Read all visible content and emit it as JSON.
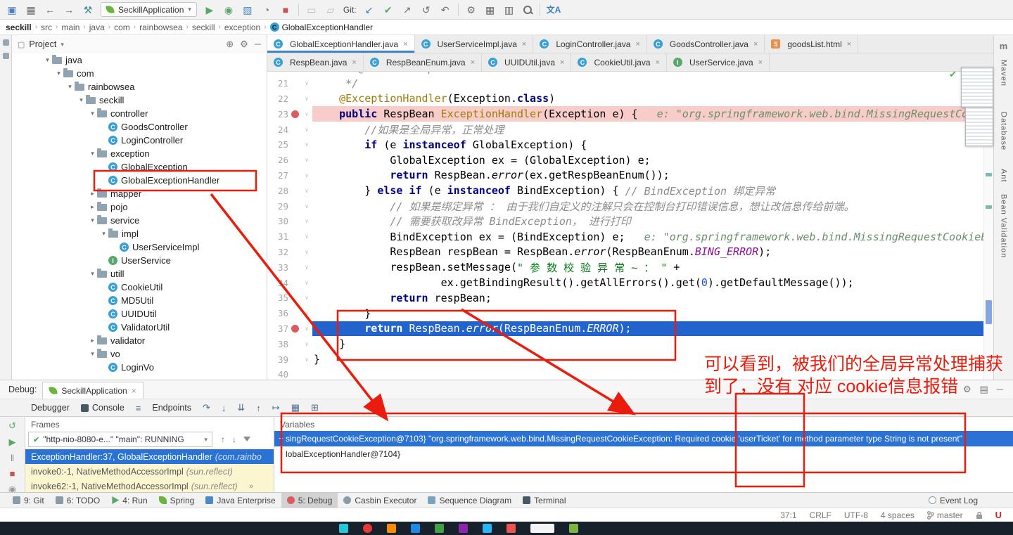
{
  "toolbar": {
    "run_config": "SeckillApplication",
    "git_label": "Git:"
  },
  "breadcrumb": {
    "items": [
      "seckill",
      "src",
      "main",
      "java",
      "com",
      "rainbowsea",
      "seckill",
      "exception",
      "GlobalExceptionHandler"
    ]
  },
  "project_panel": {
    "title": "Project",
    "tree": [
      {
        "label": "java",
        "indent": 2,
        "type": "folder",
        "state": "expanded"
      },
      {
        "label": "com",
        "indent": 3,
        "type": "folder",
        "state": "expanded"
      },
      {
        "label": "rainbowsea",
        "indent": 4,
        "type": "folder",
        "state": "expanded"
      },
      {
        "label": "seckill",
        "indent": 5,
        "type": "folder",
        "state": "expanded"
      },
      {
        "label": "controller",
        "indent": 6,
        "type": "folder",
        "state": "expanded"
      },
      {
        "label": "GoodsController",
        "indent": 7,
        "type": "class"
      },
      {
        "label": "LoginController",
        "indent": 7,
        "type": "class"
      },
      {
        "label": "exception",
        "indent": 6,
        "type": "folder",
        "state": "expanded"
      },
      {
        "label": "GlobalException",
        "indent": 7,
        "type": "class"
      },
      {
        "label": "GlobalExceptionHandler",
        "indent": 7,
        "type": "class",
        "highlight": true
      },
      {
        "label": "mapper",
        "indent": 6,
        "type": "folder",
        "state": "collapsed"
      },
      {
        "label": "pojo",
        "indent": 6,
        "type": "folder",
        "state": "collapsed"
      },
      {
        "label": "service",
        "indent": 6,
        "type": "folder",
        "state": "expanded"
      },
      {
        "label": "impl",
        "indent": 7,
        "type": "folder",
        "state": "expanded"
      },
      {
        "label": "UserServiceImpl",
        "indent": 8,
        "type": "class"
      },
      {
        "label": "UserService",
        "indent": 7,
        "type": "interface"
      },
      {
        "label": "utill",
        "indent": 6,
        "type": "folder",
        "state": "expanded"
      },
      {
        "label": "CookieUtil",
        "indent": 7,
        "type": "class"
      },
      {
        "label": "MD5Util",
        "indent": 7,
        "type": "class"
      },
      {
        "label": "UUIDUtil",
        "indent": 7,
        "type": "class"
      },
      {
        "label": "ValidatorUtil",
        "indent": 7,
        "type": "class"
      },
      {
        "label": "validator",
        "indent": 6,
        "type": "folder",
        "state": "collapsed"
      },
      {
        "label": "vo",
        "indent": 6,
        "type": "folder",
        "state": "expanded"
      },
      {
        "label": "LoginVo",
        "indent": 7,
        "type": "class"
      }
    ]
  },
  "editor": {
    "tab_rows": [
      [
        {
          "label": "GlobalExceptionHandler.java",
          "icon": "class",
          "selected": true
        },
        {
          "label": "UserServiceImpl.java",
          "icon": "class"
        },
        {
          "label": "LoginController.java",
          "icon": "class"
        },
        {
          "label": "GoodsController.java",
          "icon": "class"
        },
        {
          "label": "goodsList.html",
          "icon": "html"
        }
      ],
      [
        {
          "label": "RespBean.java",
          "icon": "class"
        },
        {
          "label": "RespBeanEnum.java",
          "icon": "class"
        },
        {
          "label": "UUIDUtil.java",
          "icon": "class"
        },
        {
          "label": "CookieUtil.java",
          "icon": "class"
        },
        {
          "label": "UserService.java",
          "icon": "interface"
        }
      ]
    ],
    "lines": [
      {
        "n": 20,
        "t": [
          [
            "c",
            "     * @return RespBean"
          ]
        ]
      },
      {
        "n": 21,
        "t": [
          [
            "c",
            "     */"
          ]
        ]
      },
      {
        "n": 22,
        "t": [
          [
            "p",
            "    "
          ],
          [
            "a",
            "@ExceptionHandler"
          ],
          [
            "p",
            "("
          ],
          [
            "p",
            "Exception."
          ],
          [
            "k",
            "class"
          ],
          [
            "p",
            ")"
          ]
        ]
      },
      {
        "n": 23,
        "bg": "bp",
        "bp": true,
        "t": [
          [
            "p",
            "    "
          ],
          [
            "k",
            "public"
          ],
          [
            "p",
            " RespBean "
          ],
          [
            "d",
            "ExceptionHandler"
          ],
          [
            "p",
            "(Exception e) {"
          ],
          [
            "h",
            "   e: \"org.springframework.web.bind.MissingRequestCookieExce"
          ]
        ]
      },
      {
        "n": 24,
        "t": [
          [
            "p",
            "        "
          ],
          [
            "c",
            "//如果是全局异常，正常处理"
          ]
        ]
      },
      {
        "n": 25,
        "t": [
          [
            "p",
            "        "
          ],
          [
            "k",
            "if"
          ],
          [
            "p",
            " (e "
          ],
          [
            "k",
            "instanceof"
          ],
          [
            "p",
            " GlobalException) {"
          ]
        ]
      },
      {
        "n": 26,
        "t": [
          [
            "p",
            "            GlobalException ex = (GlobalException) e;"
          ]
        ]
      },
      {
        "n": 27,
        "t": [
          [
            "p",
            "            "
          ],
          [
            "k",
            "return"
          ],
          [
            "p",
            " RespBean."
          ],
          [
            "i",
            "error"
          ],
          [
            "p",
            "(ex.getRespBeanEnum());"
          ]
        ]
      },
      {
        "n": 28,
        "t": [
          [
            "p",
            "        } "
          ],
          [
            "k",
            "else"
          ],
          [
            "p",
            " "
          ],
          [
            "k",
            "if"
          ],
          [
            "p",
            " (e "
          ],
          [
            "k",
            "instanceof"
          ],
          [
            "p",
            " BindException) { "
          ],
          [
            "c",
            "// BindException 绑定异常"
          ]
        ]
      },
      {
        "n": 29,
        "t": [
          [
            "p",
            "            "
          ],
          [
            "c",
            "// 如果是绑定异常 ： 由于我们自定义的注解只会在控制台打印错误信息，想让改信息传给前端。"
          ]
        ]
      },
      {
        "n": 30,
        "t": [
          [
            "p",
            "            "
          ],
          [
            "c",
            "// 需要获取改异常 BindException， 进行打印"
          ]
        ]
      },
      {
        "n": 31,
        "t": [
          [
            "p",
            "            BindException ex = (BindException) e;"
          ],
          [
            "h",
            "   e: \"org.springframework.web.bind.MissingRequestCookieExcept"
          ]
        ]
      },
      {
        "n": 32,
        "t": [
          [
            "p",
            "            RespBean respBean = RespBean."
          ],
          [
            "i",
            "error"
          ],
          [
            "p",
            "(RespBeanEnum."
          ],
          [
            "e",
            "BING_ERROR"
          ],
          [
            "p",
            ");"
          ]
        ]
      },
      {
        "n": 33,
        "t": [
          [
            "p",
            "            respBean.setMessage("
          ],
          [
            "s",
            "\" 参 数 校 验 异 常 ~ ： \""
          ],
          [
            "p",
            " +"
          ]
        ]
      },
      {
        "n": 34,
        "t": [
          [
            "p",
            "                    ex.getBindingResult().getAllErrors().get("
          ],
          [
            "num",
            "0"
          ],
          [
            "p",
            ").getDefaultMessage());"
          ]
        ]
      },
      {
        "n": 35,
        "t": [
          [
            "p",
            "            "
          ],
          [
            "k",
            "return"
          ],
          [
            "p",
            " respBean;"
          ]
        ]
      },
      {
        "n": 36,
        "t": [
          [
            "p",
            "        }"
          ]
        ]
      },
      {
        "n": 37,
        "bg": "exec",
        "bp": true,
        "t": [
          [
            "p",
            "        "
          ],
          [
            "k",
            "return"
          ],
          [
            "p",
            " RespBean."
          ],
          [
            "i",
            "error"
          ],
          [
            "p",
            "(RespBeanEnum."
          ],
          [
            "e",
            "ERROR"
          ],
          [
            "p",
            ");"
          ]
        ]
      },
      {
        "n": 38,
        "t": [
          [
            "p",
            "    }"
          ]
        ]
      },
      {
        "n": 39,
        "t": [
          [
            "p",
            "}"
          ]
        ]
      },
      {
        "n": 40,
        "t": []
      }
    ]
  },
  "debug_panel": {
    "label": "Debug:",
    "session_tab": "SeckillApplication",
    "tabs": [
      "Debugger",
      "Console",
      "Endpoints"
    ],
    "frames": {
      "title": "Frames",
      "thread": "\"http-nio-8080-e...\" \"main\": RUNNING",
      "rows": [
        {
          "text": "ExceptionHandler:37, GlobalExceptionHandler",
          "loc": "(com.rainbo",
          "sel": true
        },
        {
          "text": "invoke0:-1, NativeMethodAccessorImpl",
          "loc": "(sun.reflect)",
          "lib": true
        },
        {
          "text": "invoke62:-1, NativeMethodAccessorImpl",
          "loc": "(sun.reflect)",
          "lib": true
        }
      ]
    },
    "variables": {
      "title": "Variables",
      "rows": [
        {
          "text": "singRequestCookieException@7103} \"org.springframework.web.bind.MissingRequestCookieException: Required cookie 'userTicket' for method parameter type String is not present\"",
          "sel": true,
          "expand": "+"
        },
        {
          "text": "lobalExceptionHandler@7104}"
        }
      ]
    }
  },
  "status_bar": {
    "buttons": [
      {
        "label": "9: Git",
        "icon": "git"
      },
      {
        "label": "6: TODO",
        "icon": "todo"
      },
      {
        "label": "4: Run",
        "icon": "run"
      },
      {
        "label": "Spring",
        "icon": "spring"
      },
      {
        "label": "Java Enterprise",
        "icon": "javaee"
      },
      {
        "label": "5: Debug",
        "icon": "debug",
        "active": true
      },
      {
        "label": "Casbin Executor",
        "icon": "casbin"
      },
      {
        "label": "Sequence Diagram",
        "icon": "sequence"
      },
      {
        "label": "Terminal",
        "icon": "terminal"
      }
    ],
    "event_log": "Event Log",
    "caret": "37:1",
    "line_sep": "CRLF",
    "encoding": "UTF-8",
    "indent": "4 spaces",
    "branch": "master"
  },
  "right_strip": {
    "maven_icon": "m",
    "items": [
      "Maven",
      "Database",
      "Ant",
      "Bean Validation"
    ]
  },
  "annotation": {
    "color": "#ea1c0d",
    "line1": "可以看到，被我们的全局异常处理捕获",
    "line2": "到了，没有 对应 cookie信息报错"
  }
}
